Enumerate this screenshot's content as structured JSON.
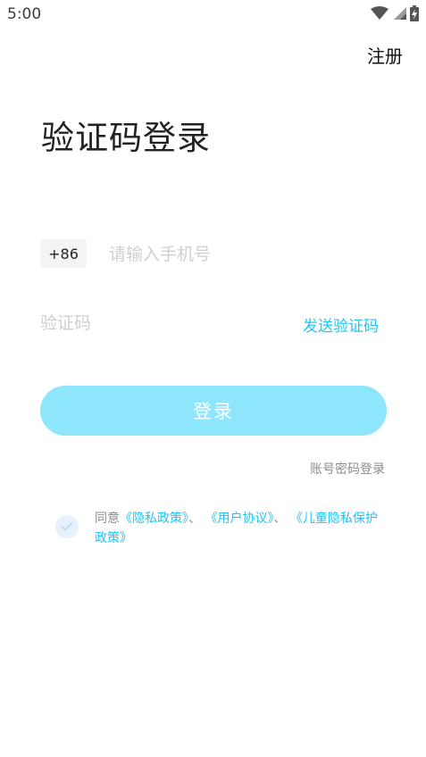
{
  "status_bar": {
    "time": "5:00",
    "icons": [
      "wifi-icon",
      "cell-signal-icon",
      "battery-charging-icon"
    ]
  },
  "header": {
    "register_label": "注册"
  },
  "title": "验证码登录",
  "phone": {
    "country_code": "+86",
    "placeholder": "请输入手机号",
    "value": ""
  },
  "code": {
    "placeholder": "验证码",
    "value": "",
    "send_label": "发送验证码"
  },
  "login_button": {
    "label": "登录",
    "color": "#8ee6fc"
  },
  "password_login_label": "账号密码登录",
  "agreement": {
    "checked": true,
    "prefix": "同意",
    "privacy_policy": "《隐私政策》",
    "sep1": "、",
    "user_agreement": "《用户协议》",
    "sep2": "、",
    "children_privacy": "《儿童隐私保护政策》"
  },
  "colors": {
    "accent": "#24c4f2",
    "button_bg": "#8ee6fc",
    "placeholder": "#cfcfcf",
    "muted_text": "#8c8c8c"
  }
}
